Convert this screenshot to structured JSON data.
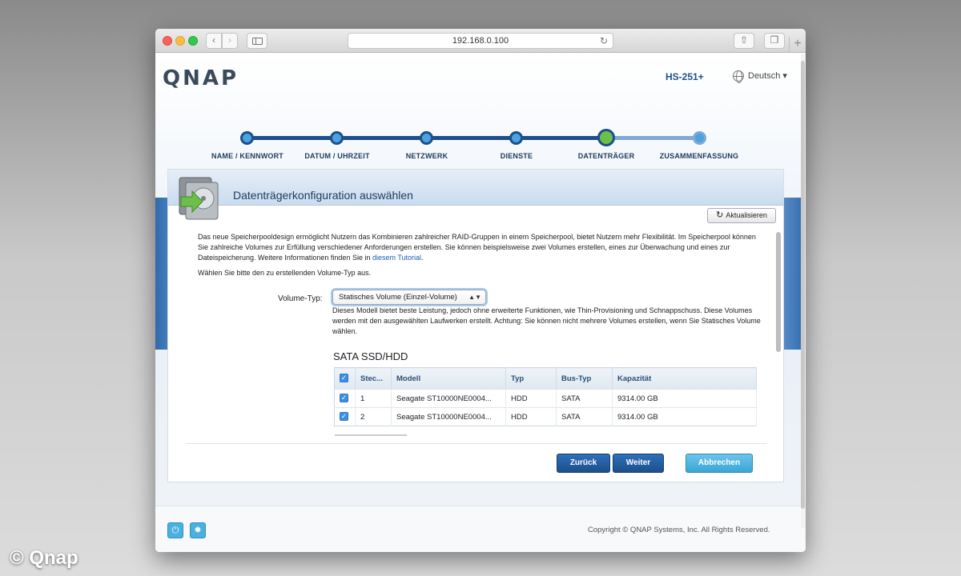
{
  "browser": {
    "url": "192.168.0.100",
    "plus_label": "+"
  },
  "header": {
    "logo": "QNAP",
    "model": "HS-251+",
    "language": "Deutsch ▾"
  },
  "stepper": {
    "steps": [
      {
        "label": "NAME / KENNWORT",
        "state": "done"
      },
      {
        "label": "DATUM / UHRZEIT",
        "state": "done"
      },
      {
        "label": "NETZWERK",
        "state": "done"
      },
      {
        "label": "DIENSTE",
        "state": "done"
      },
      {
        "label": "DATENTRÄGER",
        "state": "current"
      },
      {
        "label": "ZUSAMMENFASSUNG",
        "state": "todo"
      }
    ]
  },
  "panel": {
    "title": "Datenträgerkonfiguration auswählen",
    "refresh_label": "Aktualisieren",
    "intro_text": "Das neue Speicherpooldesign ermöglicht Nutzern das Kombinieren zahlreicher RAID-Gruppen in einem Speicherpool, bietet Nutzern mehr Flexibilität. Im Speicherpool können Sie zahlreiche Volumes zur Erfüllung verschiedener Anforderungen erstellen. Sie können beispielsweise zwei Volumes erstellen, eines zur Überwachung und eines zur Dateispeicherung. Weitere Informationen finden Sie in ",
    "intro_link": "diesem Tutorial",
    "intro_end": ".",
    "prompt": "Wählen Sie bitte den zu erstellenden Volume-Typ aus.",
    "volume_type_label": "Volume-Typ:",
    "volume_type_value": "Statisches Volume (Einzel-Volume)",
    "volume_type_desc": "Dieses Modell bietet beste Leistung, jedoch ohne erweiterte Funktionen, wie Thin-Provisioning und Schnappschuss. Diese Volumes werden mit den ausgewählten Laufwerken erstellt. Achtung: Sie können nicht mehrere Volumes erstellen, wenn Sie Statisches Volume wählen.",
    "section_title": "SATA SSD/HDD",
    "table": {
      "headers": [
        "Stec...",
        "Modell",
        "Typ",
        "Bus-Typ",
        "Kapazität"
      ],
      "rows": [
        {
          "slot": "1",
          "model": "Seagate ST10000NE0004...",
          "type": "HDD",
          "bus": "SATA",
          "capacity": "9314.00 GB",
          "checked": true
        },
        {
          "slot": "2",
          "model": "Seagate ST10000NE0004...",
          "type": "HDD",
          "bus": "SATA",
          "capacity": "9314.00 GB",
          "checked": true
        }
      ]
    },
    "buttons": {
      "back": "Zurück",
      "next": "Weiter",
      "cancel": "Abbrechen"
    }
  },
  "footer": {
    "copyright": "Copyright © QNAP Systems, Inc. All Rights Reserved."
  },
  "watermark": "© Qnap",
  "colors": {
    "primary": "#1d4f8a",
    "accent": "#4aa3e0",
    "current_step": "#6cc04a",
    "cancel": "#3aa6d6"
  },
  "icons": [
    "back-arrow-icon",
    "forward-arrow-icon",
    "sidebar-icon",
    "reload-icon",
    "share-icon",
    "tabs-icon",
    "globe-icon",
    "disk-icon",
    "refresh-icon",
    "checkbox-icon",
    "power-icon",
    "settings-icon"
  ]
}
